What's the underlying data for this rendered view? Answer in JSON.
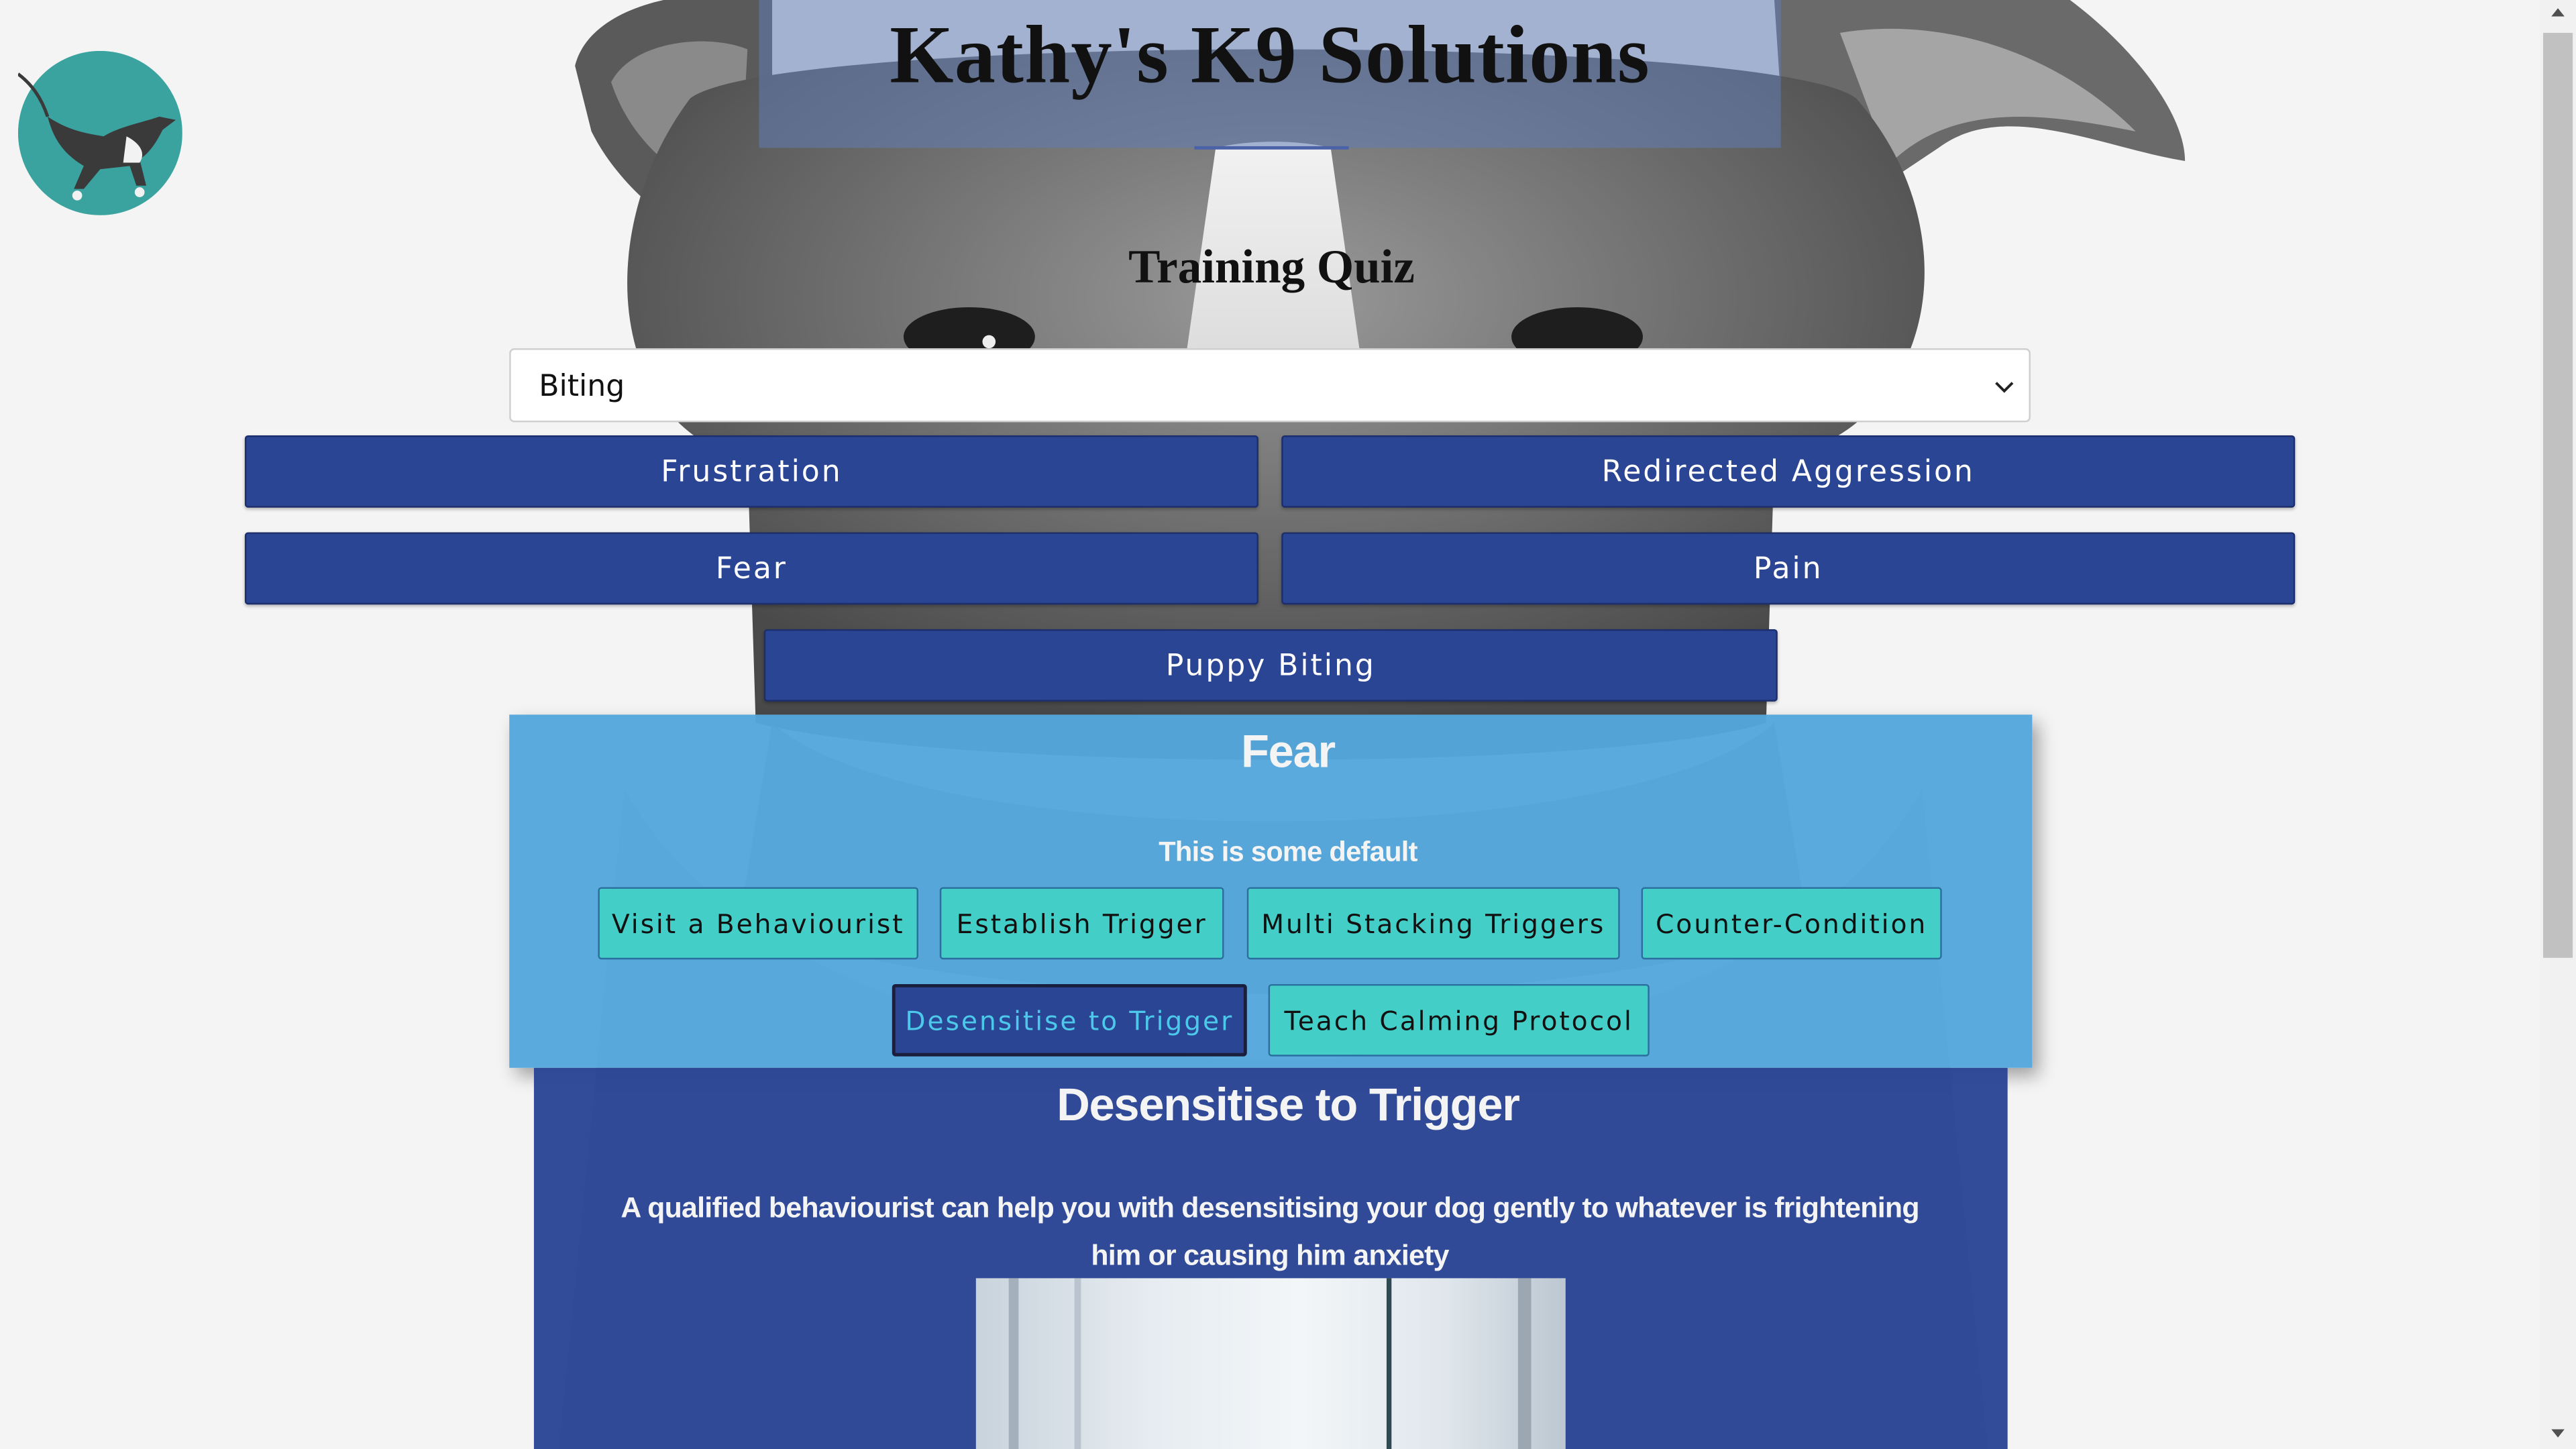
{
  "site": {
    "title": "Kathy's K9 Solutions",
    "logo_icon": "dog-logo-icon"
  },
  "quiz": {
    "heading": "Training Quiz",
    "select": {
      "selected": "Biting",
      "chevron_icon": "chevron-down-icon"
    },
    "causes": [
      {
        "label": "Frustration"
      },
      {
        "label": "Redirected Aggression"
      },
      {
        "label": "Fear"
      },
      {
        "label": "Pain"
      },
      {
        "label": "Puppy Biting"
      }
    ]
  },
  "result": {
    "title": "Fear",
    "subtitle": "This is some default",
    "steps": [
      {
        "label": "Visit a Behaviourist"
      },
      {
        "label": "Establish Trigger"
      },
      {
        "label": "Multi Stacking Triggers"
      },
      {
        "label": "Counter-Condition"
      },
      {
        "label": "Desensitise to Trigger",
        "selected": true
      },
      {
        "label": "Teach Calming Protocol"
      }
    ]
  },
  "detail": {
    "title": "Desensitise to Trigger",
    "text": "A qualified behaviourist can help you with desensitising your dog gently to whatever is frightening him or causing him anxiety"
  },
  "colors": {
    "page_bg": "#f4f4f4",
    "primary_button": "#2b4595",
    "panel_blue": "#54a7dc",
    "teal_button": "#44cec8",
    "selected_text": "#4cc8ea"
  }
}
